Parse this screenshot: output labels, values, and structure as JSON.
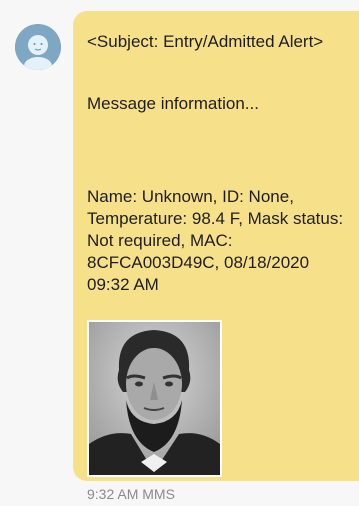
{
  "message": {
    "subject": "<Subject: Entry/Admitted Alert>",
    "info": "Message information...",
    "details": "Name: Unknown, ID: None, Temperature: 98.4 F, Mask status: Not required, MAC: 8CFCA003D49C, 08/18/2020 09:32 AM",
    "time": "9:32 AM",
    "type": "MMS"
  },
  "colors": {
    "bubble": "#f7e08a",
    "avatar": "#7ea7c3",
    "background": "#f7f7f7",
    "meta_text": "#8a8a8a"
  },
  "icons": {
    "avatar": "person-avatar-icon"
  }
}
